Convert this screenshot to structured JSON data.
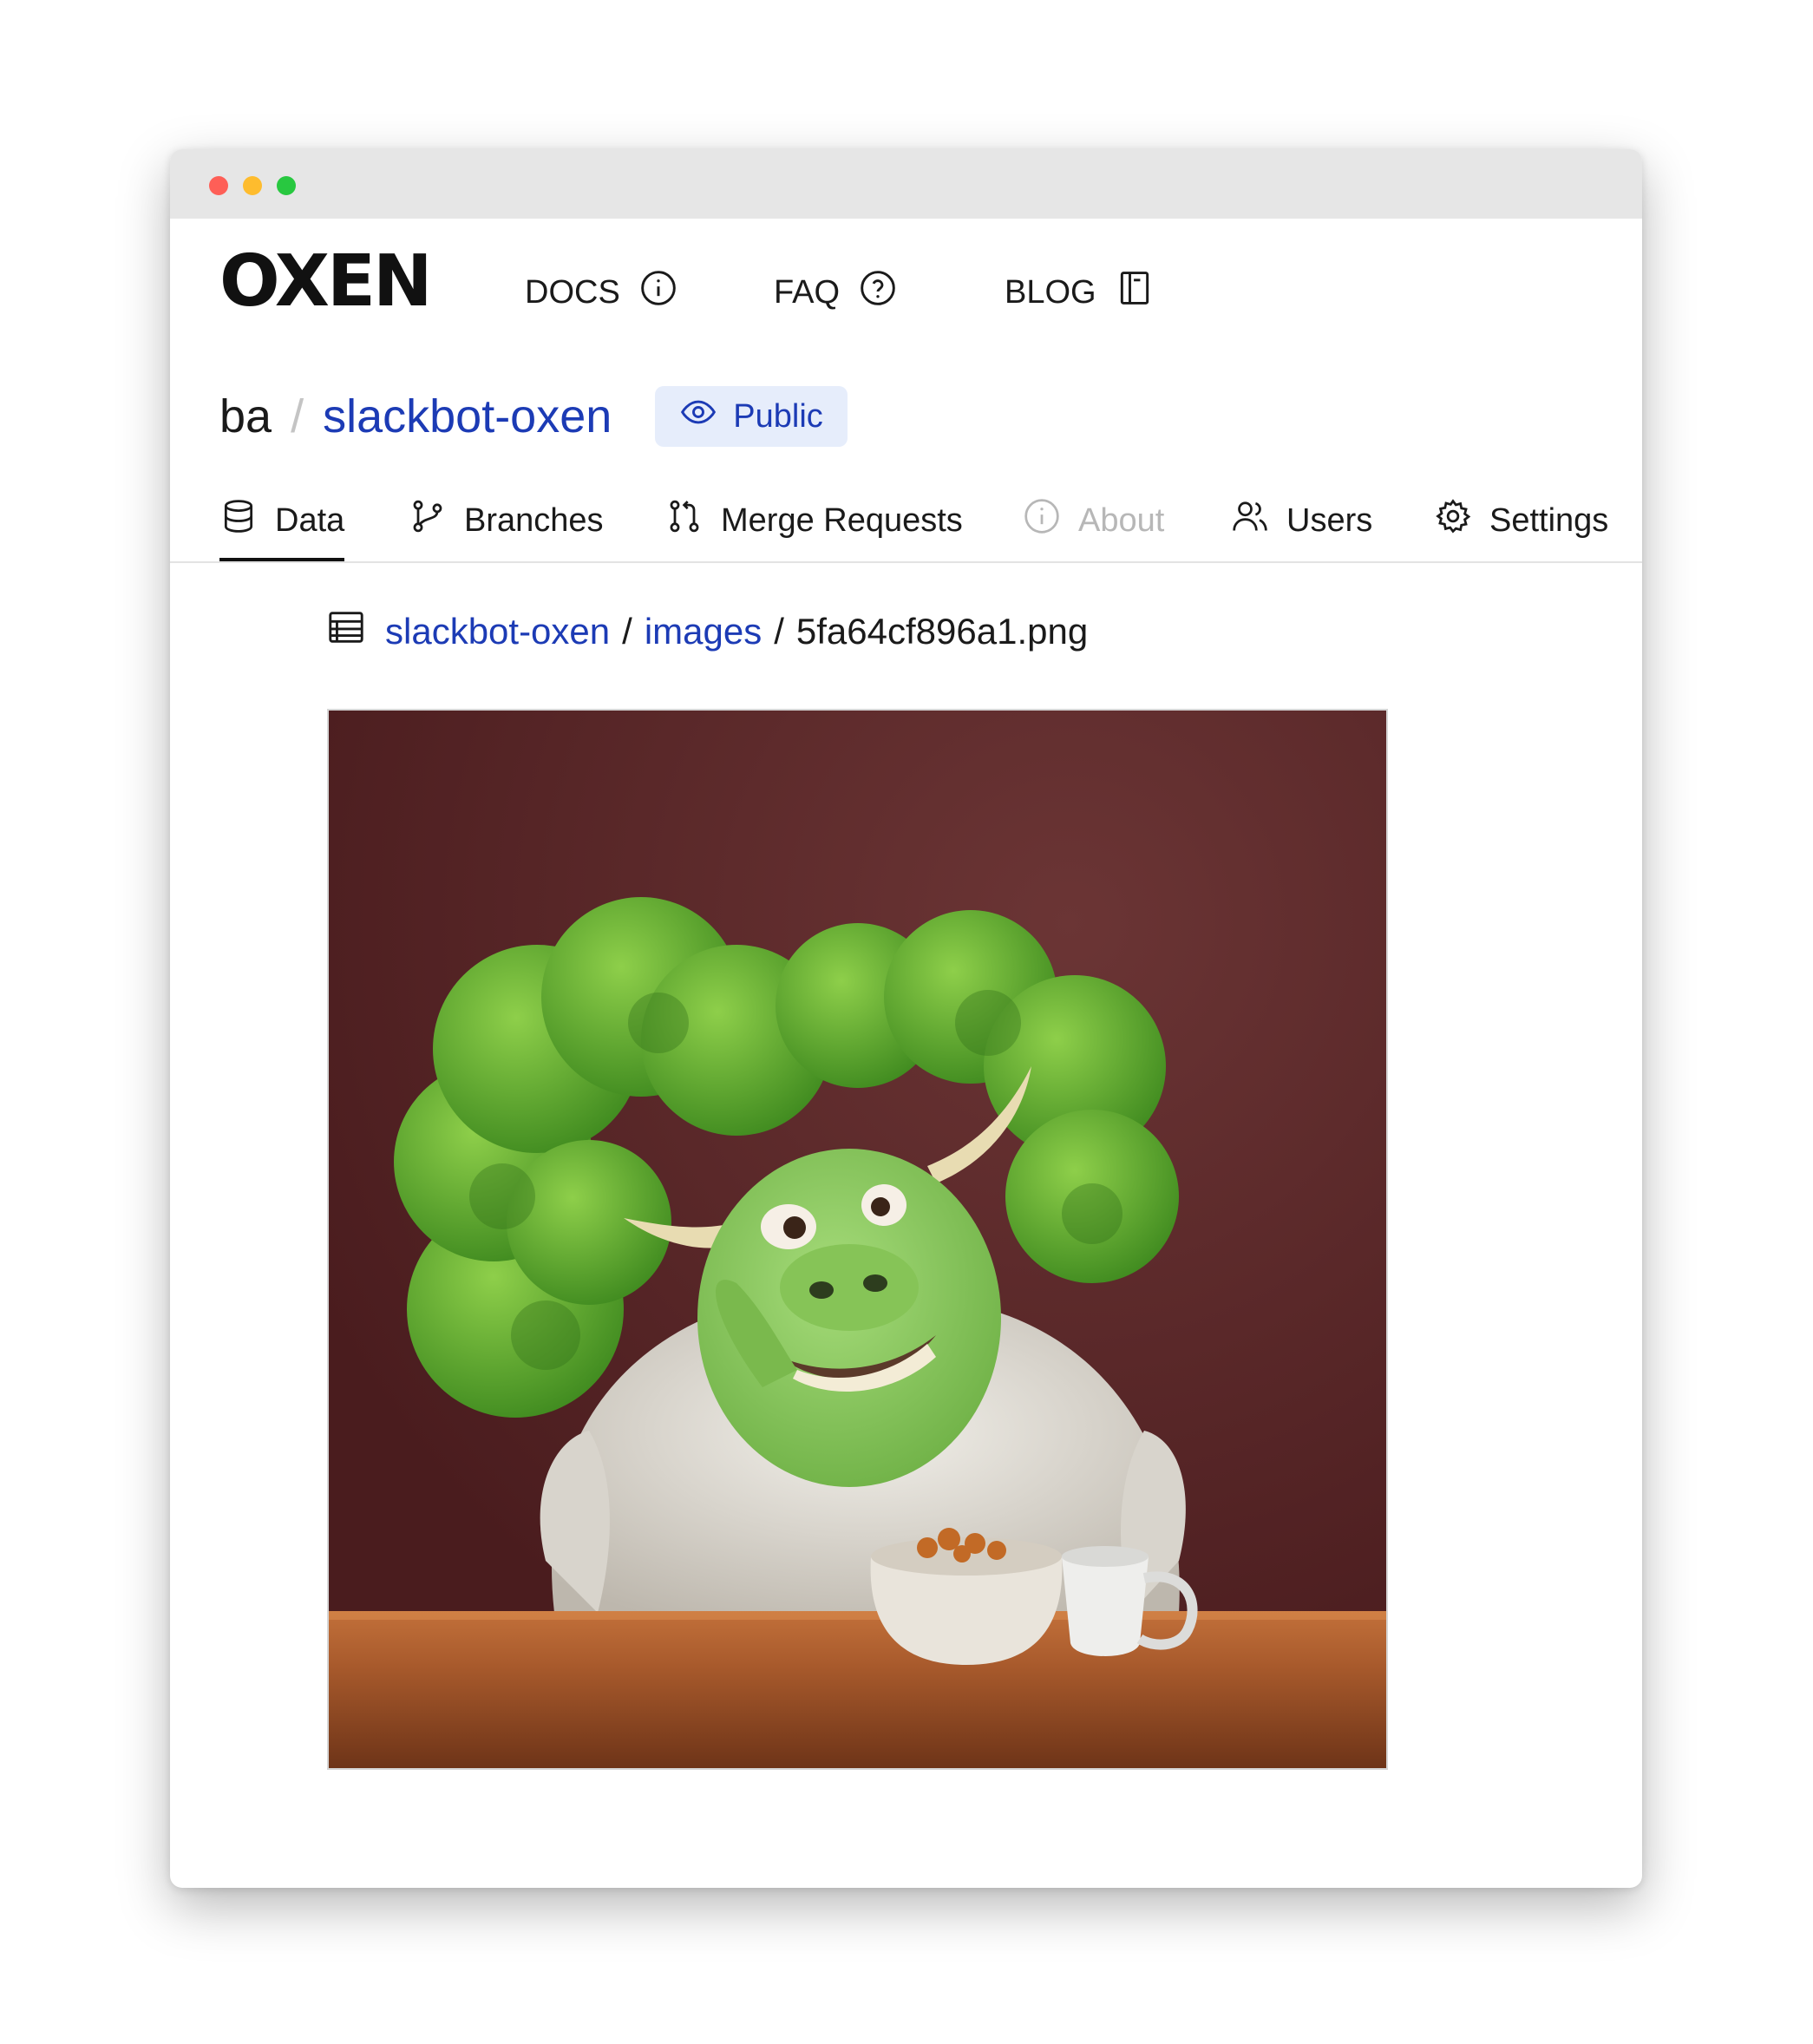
{
  "brand": {
    "logo_text": "OXEN"
  },
  "nav": [
    {
      "label": "DOCS",
      "icon": "info-circle-icon"
    },
    {
      "label": "FAQ",
      "icon": "question-circle-icon"
    },
    {
      "label": "BLOG",
      "icon": "book-icon"
    }
  ],
  "repo": {
    "owner": "ba",
    "separator": "/",
    "name": "slackbot-oxen",
    "visibility": "Public",
    "visibility_icon": "eye-icon"
  },
  "tabs": [
    {
      "label": "Data",
      "icon": "database-icon",
      "active": true
    },
    {
      "label": "Branches",
      "icon": "branch-icon"
    },
    {
      "label": "Merge Requests",
      "icon": "merge-request-icon"
    },
    {
      "label": "About",
      "icon": "info-circle-icon",
      "disabled": true
    },
    {
      "label": "Users",
      "icon": "users-icon"
    },
    {
      "label": "Settings",
      "icon": "gear-icon"
    }
  ],
  "breadcrumb": {
    "icon": "table-icon",
    "parts": [
      "slackbot-oxen",
      "images",
      "5fa64cf896a1.png"
    ],
    "separator": "/"
  },
  "colors": {
    "link": "#1c3bb5",
    "badge_bg": "#e6edfb",
    "titlebar": "#e6e6e6"
  }
}
